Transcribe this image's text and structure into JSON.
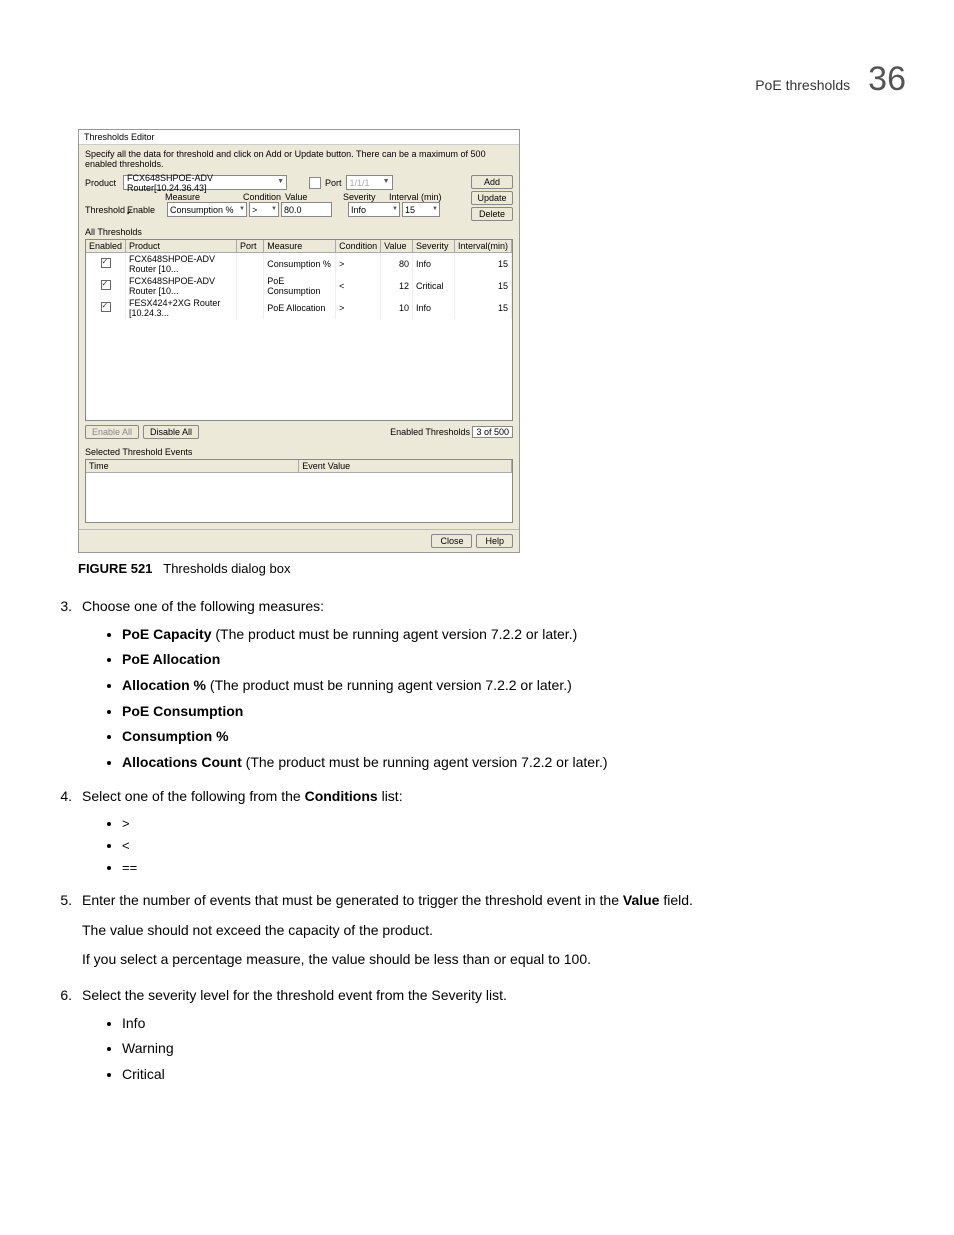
{
  "header": {
    "topic": "PoE thresholds",
    "chapter": "36"
  },
  "dialog": {
    "title": "Thresholds Editor",
    "hint": "Specify all the data for threshold and click on Add or Update button. There can be a maximum of 500 enabled thresholds.",
    "product_label": "Product",
    "product_value": "FCX648SHPOE-ADV Router[10.24.36.43]",
    "port_label": "Port",
    "port_value": "1/1/1",
    "threshold_label": "Threshold",
    "enable_label": "Enable",
    "measure_label": "Measure",
    "measure_value": "Consumption %",
    "condition_label": "Condition",
    "condition_value": ">",
    "value_label": "Value",
    "value_value": "80.0",
    "severity_label": "Severity",
    "severity_value": "Info",
    "interval_label": "Interval (min)",
    "interval_value": "15",
    "buttons": {
      "add": "Add",
      "update": "Update",
      "delete": "Delete"
    },
    "all_thresholds": "All Thresholds",
    "table": {
      "headers": [
        "Enabled",
        "Product",
        "Port",
        "Measure",
        "Condition",
        "Value",
        "Severity",
        "Interval(min)"
      ],
      "rows": [
        {
          "enabled": true,
          "product": "FCX648SHPOE-ADV Router [10...",
          "port": "",
          "measure": "Consumption %",
          "condition": ">",
          "value": "80",
          "severity": "Info",
          "interval": "15"
        },
        {
          "enabled": true,
          "product": "FCX648SHPOE-ADV Router [10...",
          "port": "",
          "measure": "PoE Consumption",
          "condition": "<",
          "value": "12",
          "severity": "Critical",
          "interval": "15"
        },
        {
          "enabled": true,
          "product": "FESX424+2XG Router [10.24.3...",
          "port": "",
          "measure": "PoE Allocation",
          "condition": ">",
          "value": "10",
          "severity": "Info",
          "interval": "15"
        }
      ]
    },
    "enable_all": "Enable All",
    "disable_all": "Disable All",
    "enabled_thresholds_label": "Enabled Thresholds",
    "enabled_thresholds_value": "3 of 500",
    "selected_events_label": "Selected Threshold Events",
    "events_headers": [
      "Time",
      "Event Value"
    ],
    "close": "Close",
    "help": "Help"
  },
  "figcap": {
    "num": "FIGURE 521",
    "text": "Thresholds dialog box"
  },
  "step3": {
    "num": "3.",
    "lead": "Choose one of the following measures:",
    "items": [
      {
        "b": "PoE Capacity",
        "rest": " (The product must be running agent version 7.2.2 or later.)"
      },
      {
        "b": "PoE Allocation",
        "rest": ""
      },
      {
        "b": "Allocation %",
        "rest": " (The product must be running agent version 7.2.2 or later.)"
      },
      {
        "b": "PoE Consumption",
        "rest": ""
      },
      {
        "b": "Consumption %",
        "rest": ""
      },
      {
        "b": "Allocations Count",
        "rest": " (The product must be running agent version 7.2.2 or later.)"
      }
    ]
  },
  "step4": {
    "num": "4.",
    "lead_pre": "Select one of the following from the ",
    "lead_b": "Conditions",
    "lead_post": " list:",
    "items": [
      ">",
      "<",
      "=="
    ]
  },
  "step5": {
    "num": "5.",
    "lead_pre": "Enter the number of events that must be generated to trigger the threshold event in the ",
    "lead_b": "Value",
    "lead_post": " field.",
    "p1": "The value should not exceed the capacity of the product.",
    "p2": "If you select a percentage measure, the value should be less than or equal to 100."
  },
  "step6": {
    "num": "6.",
    "lead": "Select the severity level for the threshold event from the Severity list.",
    "items": [
      "Info",
      "Warning",
      "Critical"
    ]
  }
}
